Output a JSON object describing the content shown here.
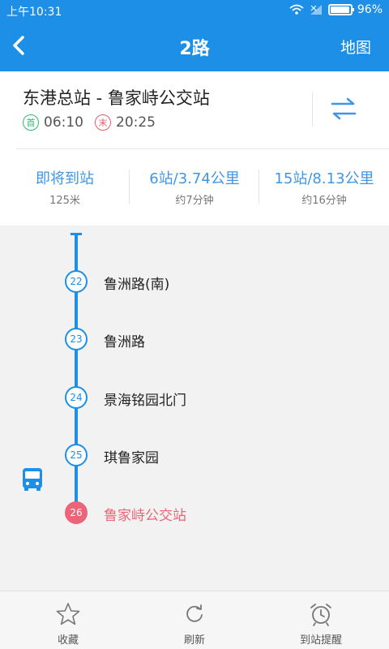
{
  "status_bar": {
    "time": "上午10:31",
    "battery": "96%",
    "battery_level": 0.96
  },
  "header": {
    "title": "2路",
    "back_icon": "chevron-left-icon",
    "map_label": "地图"
  },
  "route": {
    "name": "东港总站 - 鲁家峙公交站",
    "first_label": "首",
    "first_time": "06:10",
    "last_label": "末",
    "last_time": "20:25",
    "swap_icon": "swap-arrows-icon"
  },
  "arrivals": [
    {
      "main": "即将到站",
      "sub": "125米"
    },
    {
      "main": "6站/3.74公里",
      "sub": "约7分钟"
    },
    {
      "main": "15站/8.13公里",
      "sub": "约16分钟"
    }
  ],
  "stops": [
    {
      "num": "22",
      "name": "鲁洲路(南)"
    },
    {
      "num": "23",
      "name": "鲁洲路"
    },
    {
      "num": "24",
      "name": "景海铭园北门"
    },
    {
      "num": "25",
      "name": "琪鲁家园"
    },
    {
      "num": "26",
      "name": "鲁家峙公交站"
    }
  ],
  "bus_icon": "bus-icon",
  "nav": [
    {
      "icon": "star-icon",
      "label": "收藏"
    },
    {
      "icon": "refresh-icon",
      "label": "刷新"
    },
    {
      "icon": "alarm-clock-icon",
      "label": "到站提醒"
    }
  ],
  "colors": {
    "primary": "#1d8fe6",
    "accent_red": "#ea6577",
    "first_green": "#2fb872",
    "eta_blue": "#3f96e6"
  }
}
